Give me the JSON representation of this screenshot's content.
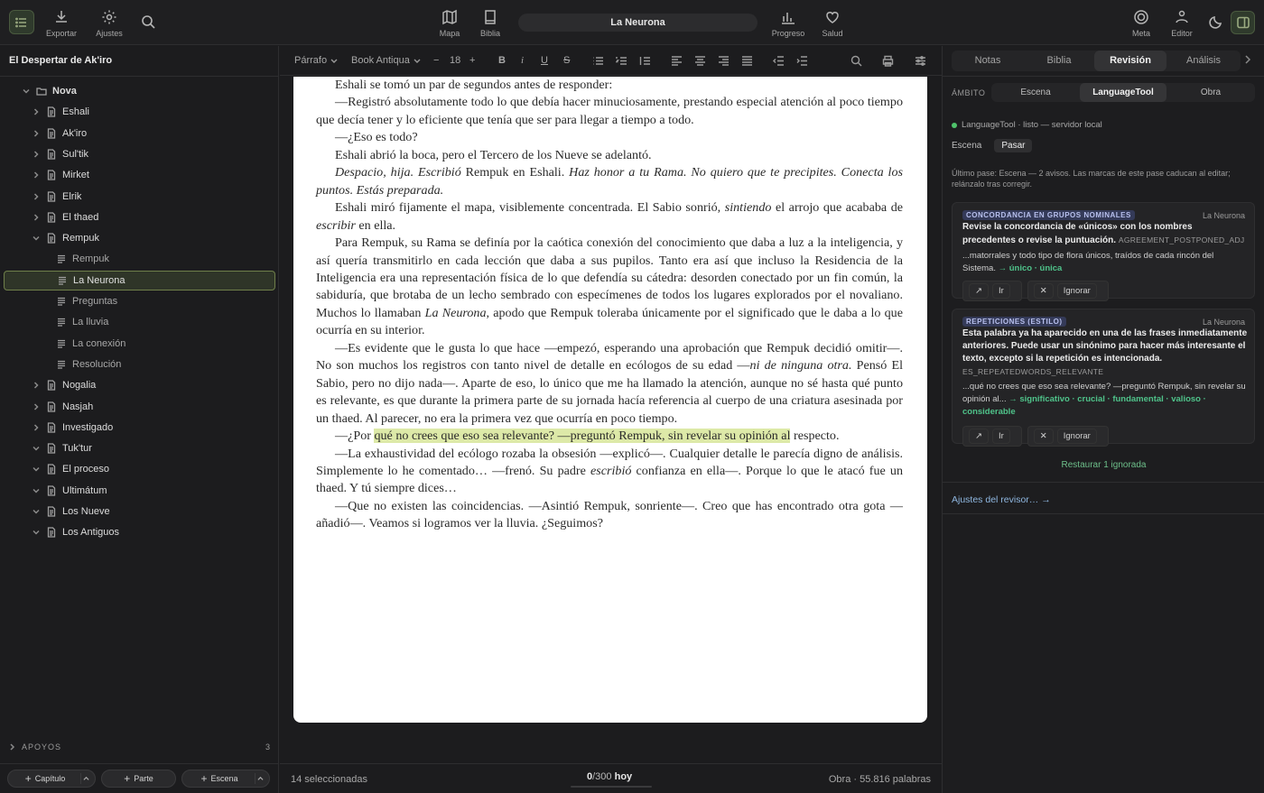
{
  "topbar": {
    "export_label": "Exportar",
    "settings_label": "Ajustes",
    "map_label": "Mapa",
    "bible_label": "Biblia",
    "doc_title": "La Neurona",
    "progress_label": "Progreso",
    "health_label": "Salud",
    "meta_label": "Meta",
    "editor_label": "Editor"
  },
  "sidebar": {
    "project_title": "El Despertar de Ak'iro",
    "tree": [
      {
        "label": "Nova",
        "kind": "folder",
        "expanded": true
      },
      {
        "label": "Eshali",
        "kind": "chapter",
        "expanded": false
      },
      {
        "label": "Ak'iro",
        "kind": "chapter",
        "expanded": false
      },
      {
        "label": "Sul'tik",
        "kind": "chapter",
        "expanded": false
      },
      {
        "label": "Mirket",
        "kind": "chapter",
        "expanded": false
      },
      {
        "label": "Elrik",
        "kind": "chapter",
        "expanded": false
      },
      {
        "label": "El thaed",
        "kind": "chapter",
        "expanded": false
      },
      {
        "label": "Rempuk",
        "kind": "chapter",
        "expanded": true
      },
      {
        "label": "Rempuk",
        "kind": "scene"
      },
      {
        "label": "La Neurona",
        "kind": "scene",
        "selected": true
      },
      {
        "label": "Preguntas",
        "kind": "scene"
      },
      {
        "label": "La lluvia",
        "kind": "scene"
      },
      {
        "label": "La conexión",
        "kind": "scene"
      },
      {
        "label": "Resolución",
        "kind": "scene"
      },
      {
        "label": "Nogalia",
        "kind": "chapter",
        "expanded": false
      },
      {
        "label": "Nasjah",
        "kind": "chapter",
        "expanded": false
      },
      {
        "label": "Investigado",
        "kind": "chapter",
        "expanded": false
      },
      {
        "label": "Tuk'tur",
        "kind": "chapter",
        "expanded": true
      },
      {
        "label": "El proceso",
        "kind": "chapter",
        "expanded": true
      },
      {
        "label": "Ultimátum",
        "kind": "chapter",
        "expanded": true
      },
      {
        "label": "Los Nueve",
        "kind": "chapter",
        "expanded": true
      },
      {
        "label": "Los Antiguos",
        "kind": "chapter",
        "expanded": true
      }
    ],
    "apoyos_label": "APOYOS",
    "apoyos_count": "3",
    "add_chapter": "Capítulo",
    "add_part": "Parte",
    "add_scene": "Escena"
  },
  "toolbar": {
    "style": "Párrafo",
    "font": "Book Antiqua",
    "size": "18"
  },
  "manuscript": {
    "p1": "Eshali se tomó un par de segundos antes de responder:",
    "p2": "—Registró absolutamente todo lo que debía hacer minuciosamente, prestando especial atención al poco tiempo que decía tener y lo eficiente que tenía que ser para llegar a tiempo a todo.",
    "p3": "—¿Eso es todo?",
    "p4": "Eshali abrió la boca, pero el Tercero de los Nueve se adelantó.",
    "p5a": "Despacio, hija. Escribió",
    "p5b": " Rempuk en Eshali. ",
    "p5c": "Haz honor a tu Rama. No quiero que te precipites. Conecta los puntos. Estás preparada.",
    "p6a": "Eshali miró fijamente el mapa, visiblemente concentrada. El Sabio sonrió, ",
    "p6b": "sintiendo",
    "p6c": " el arrojo que acababa de ",
    "p6d": "escribir",
    "p6e": " en ella.",
    "p7a": "Para Rempuk, su Rama se definía por la caótica conexión del conocimiento que daba a luz a la inteligencia, y así quería transmitirlo en cada lección que daba a sus pupilos. Tanto era así que incluso la Residencia de la Inteligencia era una representación física de lo que defendía su cátedra: desorden conectado por un fin común, la sabiduría, que brotaba de un lecho sembrado con especímenes de todos los lugares explorados por el novaliano. Muchos lo llamaban ",
    "p7b": "La Neurona",
    "p7c": ", apodo que Rempuk toleraba únicamente por el significado que le daba a lo que ocurría en su interior.",
    "p8a": "—Es evidente que le gusta lo que hace —empezó, esperando una aprobación que Rempuk decidió omitir—. No son muchos los registros con tanto nivel de detalle en ecólogos de su edad —",
    "p8b": "ni de ninguna otra.",
    "p8c": " Pensó El Sabio, pero no dijo nada—. Aparte de eso, lo único que me ha llamado la atención, aunque no sé hasta qué punto es relevante, es que durante la primera parte de su jornada hacía referencia al cuerpo de una criatura asesinada por un thaed. Al parecer, no era la primera vez que ocurría en poco tiempo.",
    "p9a": "—¿Por ",
    "p9b": "qué no crees que eso sea relevante? —preguntó Rempuk, sin revelar su opinión al",
    "p9c": " respecto.",
    "p10a": "—La exhaustividad del ecólogo rozaba la obsesión —explicó—. Cualquier detalle le parecía digno de análisis. Simplemente lo he comentado… —frenó. Su padre ",
    "p10b": "escribió",
    "p10c": " confianza en ella—. Porque lo que le atacó fue un thaed. Y tú siempre dices…",
    "p11": "—Que no existen las coincidencias. —Asintió Rempuk, sonriente—. Creo que has encontrado otra gota —añadió—. Veamos si logramos ver la lluvia. ¿Seguimos?"
  },
  "status": {
    "selected": "14 seleccionadas",
    "goal_done": "0",
    "goal_total": "/300",
    "goal_label": "hoy",
    "wordcount": "Obra · 55.816 palabras"
  },
  "rpanel": {
    "tabs": [
      "Notas",
      "Biblia",
      "Revisión",
      "Análisis"
    ],
    "active_tab": "Revisión",
    "ambito_label": "ÁMBITO",
    "scopes": [
      "Escena",
      "LanguageTool",
      "Obra"
    ],
    "lt_status": "LanguageTool · listo — servidor local",
    "sub_tabs": [
      "Escena",
      "Pasar"
    ],
    "last_pass": "Último pase: Escena — 2 avisos. Las marcas de este pase caducan al editar; relánzalo tras corregir.",
    "cards": [
      {
        "tag": "CONCORDANCIA EN GRUPOS NOMINALES",
        "scene": "La Neurona",
        "message": "Revise la concordancia de «únicos» con los nombres precedentes o revise la puntuación.",
        "rule": "AGREEMENT_POSTPONED_ADJ",
        "context": "...matorrales y todo tipo de flora únicos, traídos de cada rincón del Sistema.",
        "suggestions": "→ único · única",
        "go": "Ir",
        "ignore": "Ignorar"
      },
      {
        "tag": "REPETICIONES (ESTILO)",
        "scene": "La Neurona",
        "message": "Esta palabra ya ha aparecido en una de las frases inmediatamente anteriores. Puede usar un sinónimo para hacer más interesante el texto, excepto si la repetición es intencionada.",
        "rule": "ES_REPEATEDWORDS_RELEVANTE",
        "context": "...qué no crees que eso sea relevante? —preguntó Rempuk, sin revelar su opinión al...",
        "suggestions": "→ significativo · crucial · fundamental · valioso · considerable",
        "go": "Ir",
        "ignore": "Ignorar"
      }
    ],
    "restore": "Restaurar 1 ignorada",
    "reviewer_settings": "Ajustes del revisor… →"
  },
  "colors": {
    "accent_green": "#6f7f4a",
    "highlight": "#dde9a8",
    "suggestion": "#4fc38a",
    "status_dot": "#4fc36b"
  }
}
